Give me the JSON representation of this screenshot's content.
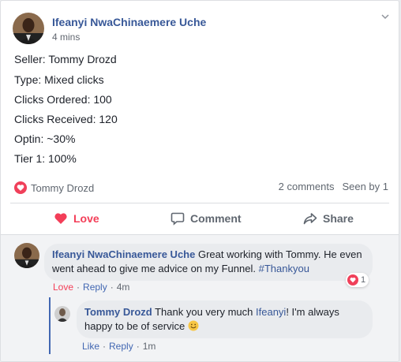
{
  "post": {
    "author": "Ifeanyi NwaChinaemere Uche",
    "time": "4 mins",
    "lines": [
      "Seller: Tommy Drozd",
      "Type: Mixed clicks",
      "Clicks Ordered: 100",
      "Clicks Received: 120",
      "Optin: ~30%",
      "Tier 1: 100%"
    ],
    "reactor": "Tommy Drozd",
    "comments_count": "2 comments",
    "seen_by": "Seen by 1"
  },
  "actions": {
    "love": "Love",
    "comment": "Comment",
    "share": "Share"
  },
  "comments": [
    {
      "author": "Ifeanyi NwaChinaemere Uche",
      "text": "Great working with Tommy. He even went ahead to give me advice on my Funnel.",
      "hashtag": "#Thankyou",
      "love": "Love",
      "reply": "Reply",
      "time": "4m",
      "reaction_count": "1"
    },
    {
      "author": "Tommy Drozd",
      "text_before": "Thank you very much",
      "mention": "Ifeanyi",
      "text_after": "! I'm always happy to be of service",
      "like": "Like",
      "reply": "Reply",
      "time": "1m"
    }
  ],
  "colors": {
    "link": "#385898",
    "love": "#f33e58",
    "muted": "#606770",
    "reply_line": "#4267b2"
  },
  "icons": [
    "chevron-down-icon",
    "heart-icon",
    "comment-icon",
    "share-icon",
    "smiley-emoji-icon"
  ]
}
